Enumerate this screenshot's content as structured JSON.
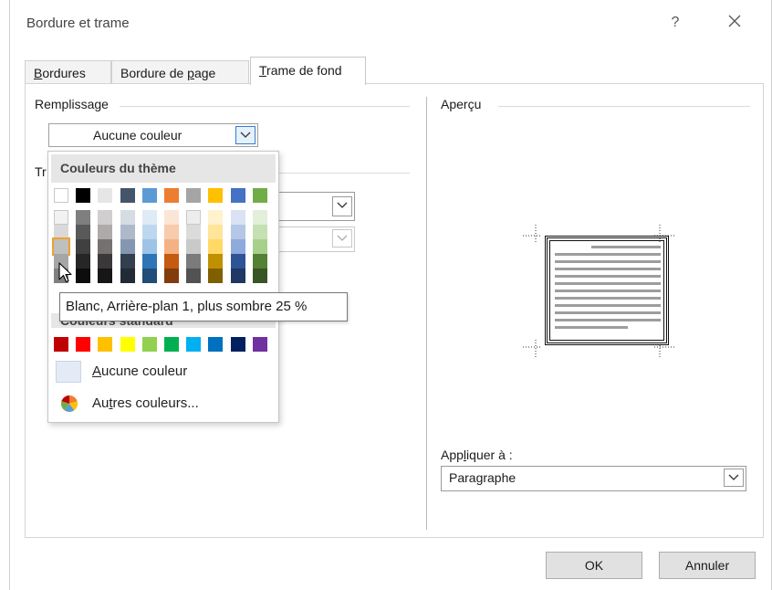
{
  "dialog": {
    "title": "Bordure et trame",
    "help_label": "?"
  },
  "tabs": [
    {
      "label_pre": "",
      "label_u": "B",
      "label_post": "ordures"
    },
    {
      "label_pre": "Bordure de ",
      "label_u": "p",
      "label_post": "age"
    },
    {
      "label_pre": "",
      "label_u": "T",
      "label_post": "rame de fond"
    }
  ],
  "fill": {
    "group_label": "Remplissage",
    "selected_value": "Aucune couleur"
  },
  "pattern": {
    "group_label_partial": "Tr"
  },
  "preview": {
    "group_label": "Aperçu"
  },
  "apply_to": {
    "label_pre": "App",
    "label_u": "l",
    "label_post": "iquer à :",
    "value": "Paragraphe"
  },
  "buttons": {
    "ok": "OK",
    "cancel": "Annuler"
  },
  "color_menu": {
    "theme_header": "Couleurs du thème",
    "standard_header": "Couleurs standard",
    "no_color_pre": "",
    "no_color_u": "A",
    "no_color_post": "ucune couleur",
    "more_colors_pre": "Au",
    "more_colors_u": "t",
    "more_colors_post": "res couleurs...",
    "tooltip": "Blanc, Arrière-plan 1, plus sombre 25 %",
    "theme_colors": [
      [
        "#FFFFFF",
        "#F2F2F2",
        "#D9D9D9",
        "#BFBFBF",
        "#A6A6A6",
        "#808080"
      ],
      [
        "#000000",
        "#7F7F7F",
        "#595959",
        "#404040",
        "#262626",
        "#0D0D0D"
      ],
      [
        "#E7E6E6",
        "#D0CECE",
        "#AEAAAA",
        "#757171",
        "#3A3838",
        "#171616"
      ],
      [
        "#44546A",
        "#D6DCE4",
        "#ADB9CA",
        "#8496B0",
        "#333F4F",
        "#222A35"
      ],
      [
        "#5B9BD5",
        "#DEEBF6",
        "#BDD7EE",
        "#9DC3E6",
        "#2E75B5",
        "#1F4E79"
      ],
      [
        "#ED7D31",
        "#FBE5D5",
        "#F7CBAC",
        "#F4B183",
        "#C55A11",
        "#833C0B"
      ],
      [
        "#A5A5A5",
        "#EDEDED",
        "#DBDBDB",
        "#C9C9C9",
        "#7B7B7B",
        "#525252"
      ],
      [
        "#FFC000",
        "#FFF2CC",
        "#FFE599",
        "#FFD965",
        "#BF9000",
        "#7F6000"
      ],
      [
        "#4472C4",
        "#DAE3F3",
        "#B4C7E7",
        "#8FAADC",
        "#2F5496",
        "#1F3864"
      ],
      [
        "#70AD47",
        "#E2EFD9",
        "#C5E0B3",
        "#A8D08D",
        "#538135",
        "#375623"
      ]
    ],
    "standard_colors": [
      "#C00000",
      "#FF0000",
      "#FFC000",
      "#FFFF00",
      "#92D050",
      "#00B050",
      "#00B0F0",
      "#0070C0",
      "#002060",
      "#7030A0"
    ]
  }
}
